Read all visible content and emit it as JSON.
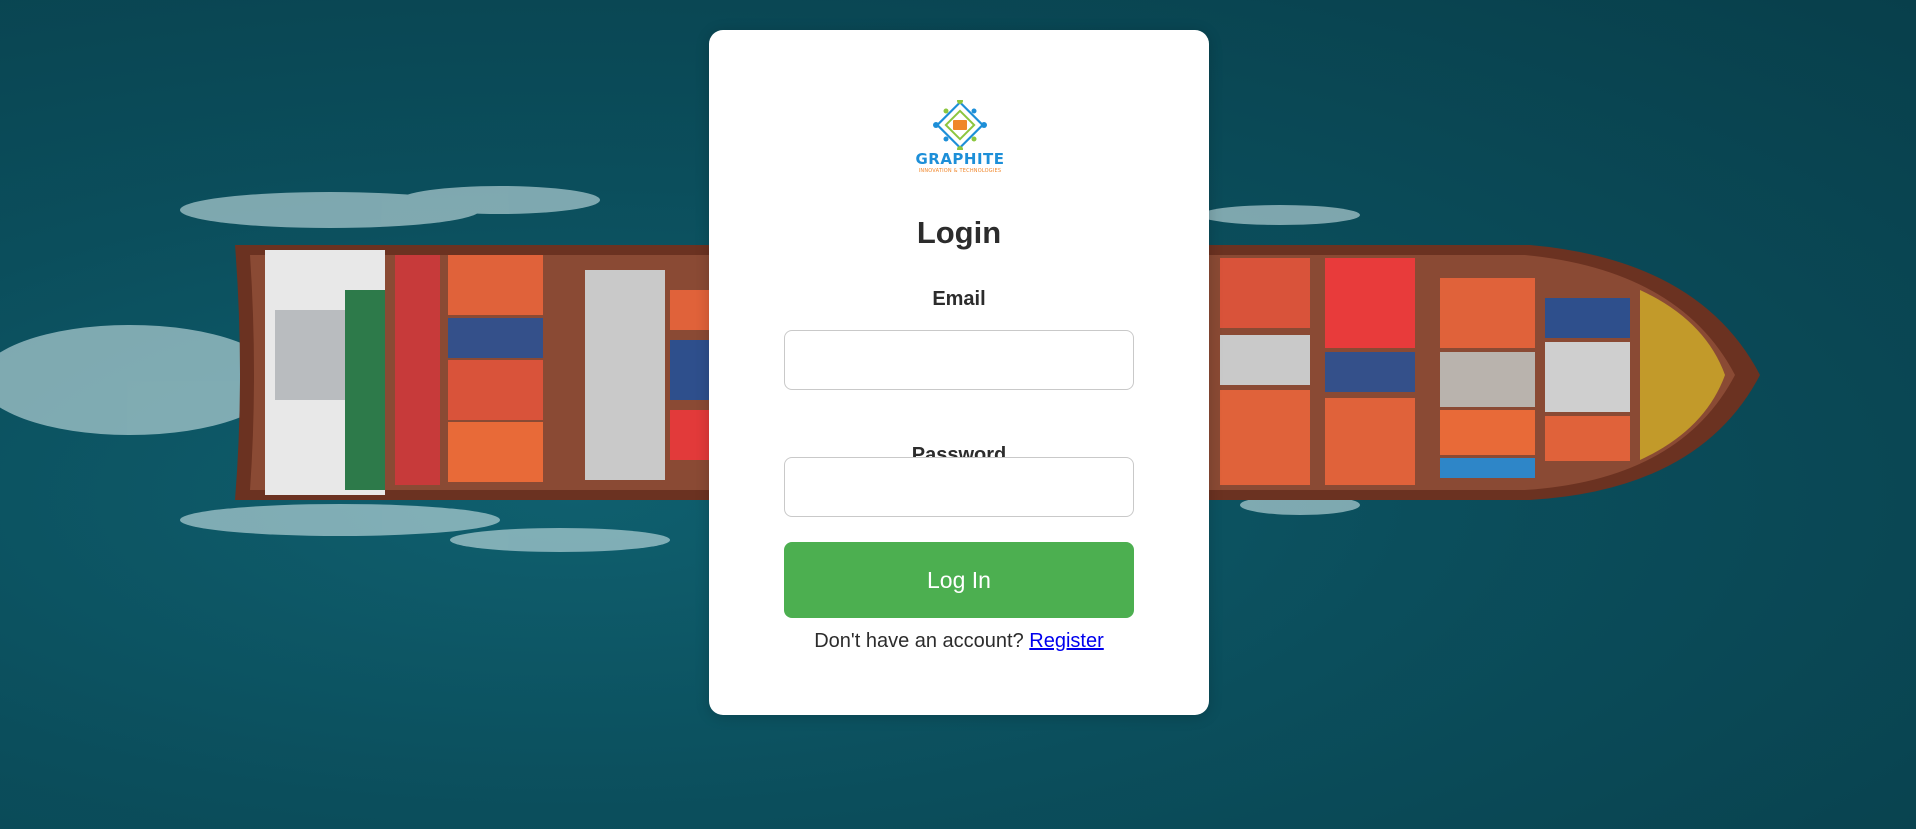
{
  "logo": {
    "name": "GRAPHITE",
    "tagline": "INNOVATION & TECHNOLOGIES"
  },
  "login": {
    "title": "Login",
    "email_label": "Email",
    "email_value": "",
    "password_label": "Password",
    "password_value": "",
    "submit_label": "Log In",
    "footer_text": "Don't have an account?",
    "register_link": "Register"
  },
  "colors": {
    "button": "#4caf50",
    "sea": "#0b4e5c",
    "link": "#0000ee"
  }
}
